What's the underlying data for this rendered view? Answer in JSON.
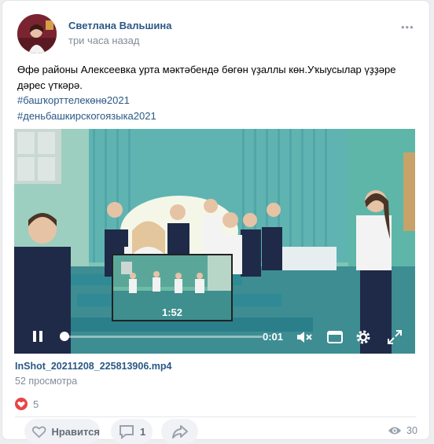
{
  "post": {
    "author": "Светлана Вальшина",
    "time": "три часа назад",
    "more_icon": "more-dots-icon",
    "text_line_1": "Өфө районы Алексеевка урта мәктәбендә бөгөн үҙаллы көн.Уҡыусылар үҙҙәре",
    "text_line_2": "дәрес үткәрә.",
    "hashtag_1": "#башҡорттелекөнө2021",
    "hashtag_2": "#деньбашкирскогоязыка2021"
  },
  "video": {
    "thumbnail_time": "1:52",
    "current_time": "0:01",
    "progress": 0.01,
    "file_name": "InShot_20211208_225813906.mp4",
    "views": "52 просмотра"
  },
  "reactions": {
    "count": "5",
    "icon": "heart-icon",
    "color": "#e64646"
  },
  "actions": {
    "like_label": "Нравится",
    "comment_count": "1",
    "share_icon": "share-icon",
    "views_total": "30"
  },
  "colors": {
    "link": "#2a5885",
    "muted": "#818c99",
    "button_bg": "#f0f2f5"
  }
}
